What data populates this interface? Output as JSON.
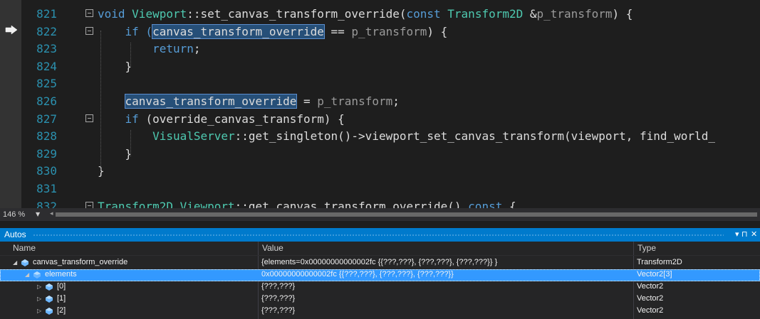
{
  "editor": {
    "zoom": "146 %",
    "lines": [
      {
        "n": "821",
        "tokens": [
          {
            "t": "void ",
            "c": "kw"
          },
          {
            "t": "Viewport",
            "c": "ty"
          },
          {
            "t": "::set_canvas_transform_override(",
            "c": "plain"
          },
          {
            "t": "const ",
            "c": "kw"
          },
          {
            "t": "Transform2D ",
            "c": "ty"
          },
          {
            "t": "&",
            "c": "plain"
          },
          {
            "t": "p_transform",
            "c": "par"
          },
          {
            "t": ") {",
            "c": "plain"
          }
        ]
      },
      {
        "n": "822",
        "tokens": [
          {
            "t": "    if (",
            "c": "kw"
          },
          {
            "t": "canvas_transform_override",
            "c": "plain",
            "hl": true
          },
          {
            "t": " == ",
            "c": "plain"
          },
          {
            "t": "p_transform",
            "c": "par"
          },
          {
            "t": ") {",
            "c": "plain"
          }
        ]
      },
      {
        "n": "823",
        "tokens": [
          {
            "t": "        return",
            "c": "kw"
          },
          {
            "t": ";",
            "c": "plain"
          }
        ]
      },
      {
        "n": "824",
        "tokens": [
          {
            "t": "    }",
            "c": "plain"
          }
        ]
      },
      {
        "n": "825",
        "tokens": []
      },
      {
        "n": "826",
        "tokens": [
          {
            "t": "    ",
            "c": "plain"
          },
          {
            "t": "canvas_transform_override",
            "c": "plain",
            "hl": true
          },
          {
            "t": " = ",
            "c": "plain"
          },
          {
            "t": "p_transform",
            "c": "par"
          },
          {
            "t": ";",
            "c": "plain"
          }
        ]
      },
      {
        "n": "827",
        "tokens": [
          {
            "t": "    if ",
            "c": "kw"
          },
          {
            "t": "(override_canvas_transform) {",
            "c": "plain"
          }
        ]
      },
      {
        "n": "828",
        "tokens": [
          {
            "t": "        ",
            "c": "plain"
          },
          {
            "t": "VisualServer",
            "c": "ty"
          },
          {
            "t": "::get_singleton()->viewport_set_canvas_transform(viewport, find_world_",
            "c": "plain"
          }
        ]
      },
      {
        "n": "829",
        "tokens": [
          {
            "t": "    }",
            "c": "plain"
          }
        ]
      },
      {
        "n": "830",
        "tokens": [
          {
            "t": "}",
            "c": "plain"
          }
        ]
      },
      {
        "n": "831",
        "tokens": []
      },
      {
        "n": "832",
        "tokens": [
          {
            "t": "Transform2D ",
            "c": "ty"
          },
          {
            "t": "Viewport",
            "c": "ty"
          },
          {
            "t": "::get_canvas_transform_override() ",
            "c": "plain"
          },
          {
            "t": "const ",
            "c": "kw"
          },
          {
            "t": "{",
            "c": "plain"
          }
        ]
      }
    ]
  },
  "autos": {
    "title": "Autos",
    "pin_label": "▾ ⊓",
    "close_label": "✕",
    "columns": {
      "name": "Name",
      "value": "Value",
      "type": "Type"
    },
    "rows": [
      {
        "name": "canvas_transform_override",
        "value": "{elements=0x00000000000002fc {{???,???}, {???,???}, {???,???}} }",
        "type": "Transform2D",
        "expander": "◢",
        "indent": 0,
        "selected": false
      },
      {
        "name": "elements",
        "value": "0x00000000000002fc {{???,???}, {???,???}, {???,???}}",
        "type": "Vector2[3]",
        "expander": "◢",
        "indent": 1,
        "selected": true
      },
      {
        "name": "[0]",
        "value": "{???,???}",
        "type": "Vector2",
        "expander": "▷",
        "indent": 2,
        "selected": false
      },
      {
        "name": "[1]",
        "value": "{???,???}",
        "type": "Vector2",
        "expander": "▷",
        "indent": 2,
        "selected": false
      },
      {
        "name": "[2]",
        "value": "{???,???}",
        "type": "Vector2",
        "expander": "▷",
        "indent": 2,
        "selected": false
      }
    ]
  },
  "colors": {
    "accent": "#007acc",
    "selection": "#3399ff",
    "editor_bg": "#1e1e1e",
    "keyword": "#569cd6",
    "type": "#4ec9b0",
    "line_number": "#2b91af"
  }
}
